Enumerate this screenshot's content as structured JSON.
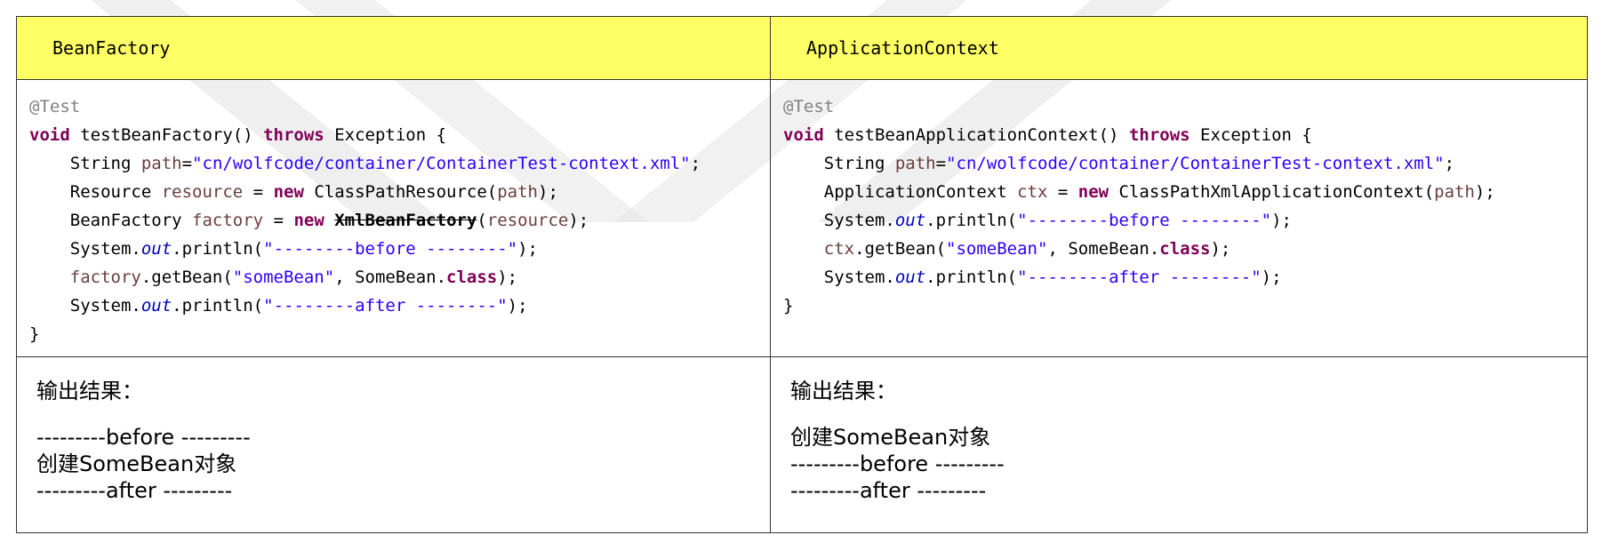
{
  "headers": {
    "left": "BeanFactory",
    "right": "ApplicationContext"
  },
  "left_code": {
    "annotation": "@Test",
    "sig_void": "void",
    "sig_name": " testBeanFactory() ",
    "sig_throws": "throws",
    "sig_rest": " Exception {",
    "l1_type": "String ",
    "l1_var": "path",
    "l1_eq": "=",
    "l1_str": "\"cn/wolfcode/container/ContainerTest-context.xml\"",
    "l1_end": ";",
    "l2_type": "Resource ",
    "l2_var": "resource",
    "l2_eq": " = ",
    "l2_new": "new",
    "l2_call": " ClassPathResource(",
    "l2_arg": "path",
    "l2_end": ");",
    "l3_type": "BeanFactory ",
    "l3_var": "factory",
    "l3_eq": " = ",
    "l3_new": "new",
    "l3_space": " ",
    "l3_strike": "XmlBeanFactory",
    "l3_open": "(",
    "l3_arg": "resource",
    "l3_end": ");",
    "l4_sys": "System.",
    "l4_out": "out",
    "l4_call": ".println(",
    "l4_str": "\"--------before --------\"",
    "l4_end": ");",
    "l5_var": "factory",
    "l5_call": ".getBean(",
    "l5_str": "\"someBean\"",
    "l5_mid": ", SomeBean.",
    "l5_class": "class",
    "l5_end": ");",
    "l6_sys": "System.",
    "l6_out": "out",
    "l6_call": ".println(",
    "l6_str": "\"--------after --------\"",
    "l6_end": ");",
    "close": "}"
  },
  "right_code": {
    "annotation": "@Test",
    "sig_void": "void",
    "sig_name": " testBeanApplicationContext() ",
    "sig_throws": "throws",
    "sig_rest": " Exception {",
    "l1_type": "String ",
    "l1_var": "path",
    "l1_eq": "=",
    "l1_str": "\"cn/wolfcode/container/ContainerTest-context.xml\"",
    "l1_end": ";",
    "l2_type": "ApplicationContext ",
    "l2_var": "ctx",
    "l2_eq": " = ",
    "l2_new": "new",
    "l2_call": " ClassPathXmlApplicationContext(",
    "l2_arg": "path",
    "l2_end": ");",
    "l3_sys": "System.",
    "l3_out": "out",
    "l3_call": ".println(",
    "l3_str": "\"--------before --------\"",
    "l3_end": ");",
    "l4_var": "ctx",
    "l4_call": ".getBean(",
    "l4_str": "\"someBean\"",
    "l4_mid": ", SomeBean.",
    "l4_class": "class",
    "l4_end": ");",
    "l5_sys": "System.",
    "l5_out": "out",
    "l5_call": ".println(",
    "l5_str": "\"--------after --------\"",
    "l5_end": ");",
    "close": "}"
  },
  "left_output": {
    "title": "输出结果：",
    "line1": "---------before ---------",
    "line2": "创建SomeBean对象",
    "line3": "---------after ---------"
  },
  "right_output": {
    "title": "输出结果：",
    "line1": "创建SomeBean对象",
    "line2": "---------before ---------",
    "line3": "---------after ---------"
  },
  "colors": {
    "header_bg": "#ffff66",
    "keyword": "#7f0055",
    "string": "#2a00ff",
    "variable": "#6a3e3e",
    "field": "#0000c0",
    "annotation": "#808080"
  }
}
